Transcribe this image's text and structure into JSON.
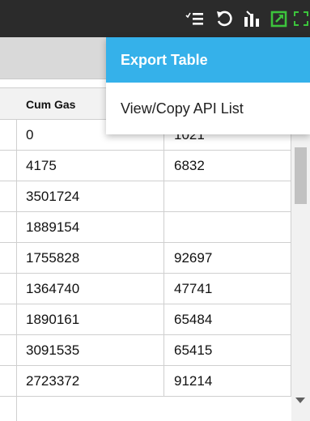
{
  "toolbar": {
    "icons": [
      "check-list-icon",
      "undo-icon",
      "bar-chart-icon",
      "export-icon",
      "fullscreen-icon"
    ],
    "accent": "#3cc43c"
  },
  "menu": {
    "items": [
      {
        "label": "Export Table",
        "active": true
      },
      {
        "label": "View/Copy API List",
        "active": false
      }
    ],
    "active_color": "#35b1ea"
  },
  "table": {
    "columns": [
      "Cum Gas",
      ""
    ],
    "rows": [
      [
        "0",
        "1021"
      ],
      [
        "4175",
        "6832"
      ],
      [
        "3501724",
        ""
      ],
      [
        "1889154",
        ""
      ],
      [
        "1755828",
        "92697"
      ],
      [
        "1364740",
        "47741"
      ],
      [
        "1890161",
        "65484"
      ],
      [
        "3091535",
        "65415"
      ],
      [
        "2723372",
        "91214"
      ]
    ]
  }
}
